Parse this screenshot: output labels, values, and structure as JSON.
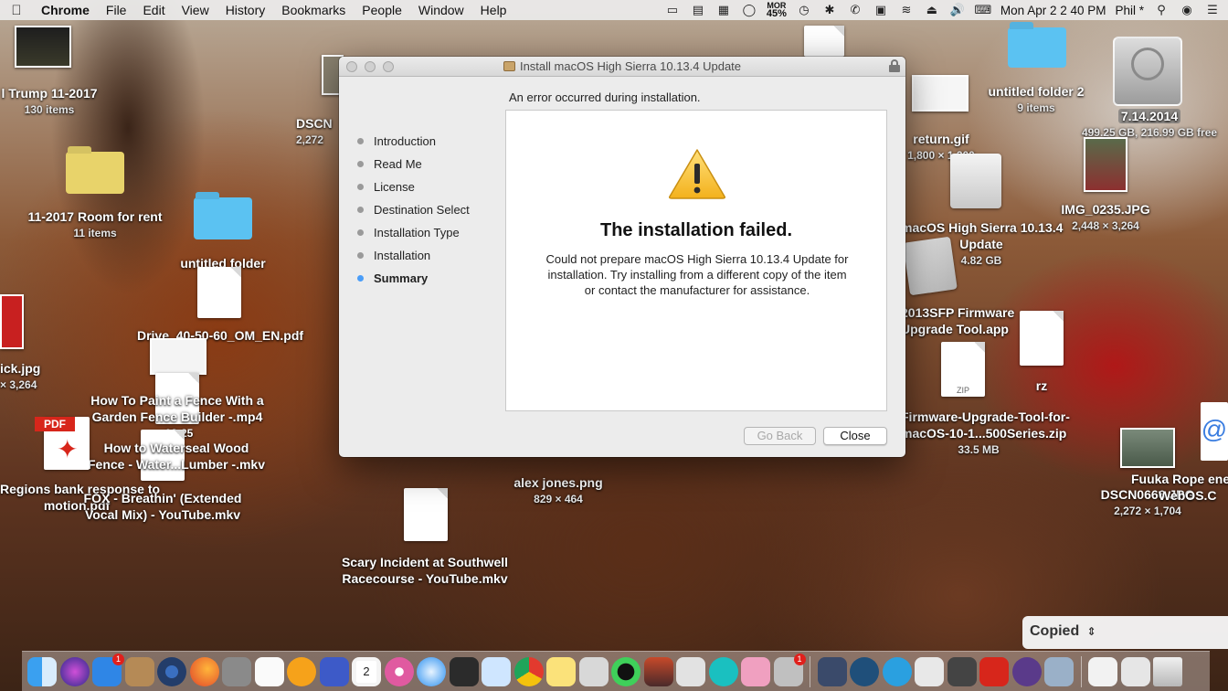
{
  "menubar": {
    "app": "Chrome",
    "menus": [
      "File",
      "Edit",
      "View",
      "History",
      "Bookmarks",
      "People",
      "Window",
      "Help"
    ],
    "battery_top": "MOR",
    "battery_pct": "45%",
    "clock": "Mon Apr 2  2 40 PM",
    "user": "Phil *"
  },
  "desktop": {
    "trump_folder": {
      "name": "l Trump 11-2017",
      "sub": "130 items"
    },
    "room_folder": {
      "name": "11-2017 Room for rent",
      "sub": "11 items"
    },
    "untitled_folder_left": {
      "name": "untitled folder"
    },
    "drive_pdf": {
      "name": "Drive_40-50-60_OM_EN.pdf"
    },
    "dscn_left": {
      "name": "DSCN",
      "sub": "2,272"
    },
    "ck_jpg": {
      "name": "ick.jpg",
      "sub": "× 3,264"
    },
    "paint_fence": {
      "name": "How To Paint a Fence With a",
      "name2": "Garden Fence Builder -.mp4",
      "duration": "02:25"
    },
    "waterseal": {
      "name": "How to Waterseal Wood",
      "name2": "Fence - Water...Lumber -.mkv"
    },
    "regions_pdf": {
      "name": "Regions bank response to",
      "name2": "motion.pdf"
    },
    "fox": {
      "name": "FOX - Breathin' (Extended",
      "name2": "Vocal Mix) - YouTube.mkv"
    },
    "alex_jones": {
      "name": "alex jones.png",
      "sub": "829 × 464"
    },
    "scary": {
      "name": "Scary Incident at Southwell",
      "name2": "Racecourse - YouTube.mkv"
    },
    "return_gif": {
      "name": "return.gif",
      "sub": "1,800 × 1,200"
    },
    "untitled_folder_2": {
      "name": "untitled folder 2",
      "sub": "9 items"
    },
    "disk": {
      "name": "7.14.2014",
      "sub": "499.25 GB, 216.99 GB free"
    },
    "img_0235": {
      "name": "IMG_0235.JPG",
      "sub": "2,448 × 3,264"
    },
    "macos_installer": {
      "name": "macOS High Sierra 10.13.4",
      "name2": "Update",
      "sub": "4.82 GB"
    },
    "firmware_app": {
      "name": "2013SFP Firmware",
      "name2": "Upgrade Tool.app"
    },
    "rz": {
      "name": "rz"
    },
    "firmware_zip": {
      "name": "Firmware-Upgrade-Tool-for-",
      "name2": "macOS-10-1...500Series.zip",
      "sub": "33.5 MB",
      "zip_label": "ZIP"
    },
    "dscn0666": {
      "name": "DSCN0666.JPG",
      "sub": "2,272 × 1,704"
    },
    "fuuka": {
      "name": "Fuuka Rope ene",
      "name2": "WebOS.C"
    }
  },
  "installer": {
    "title": "Install macOS High Sierra 10.13.4 Update",
    "error_heading": "An error occurred during installation.",
    "steps": [
      "Introduction",
      "Read Me",
      "License",
      "Destination Select",
      "Installation Type",
      "Installation",
      "Summary"
    ],
    "active_step": "Summary",
    "fail_title": "The installation failed.",
    "fail_message": "Could not prepare macOS High Sierra 10.13.4 Update for installation. Try installing from a different copy of the item or contact the manufacturer for assistance.",
    "go_back": "Go Back",
    "close": "Close"
  },
  "copied_popup": {
    "label": "Copied",
    "chevron": "⌃"
  },
  "dock": {
    "calendar_day": "2",
    "badges": {
      "app_store": "1",
      "photo": "1"
    }
  }
}
